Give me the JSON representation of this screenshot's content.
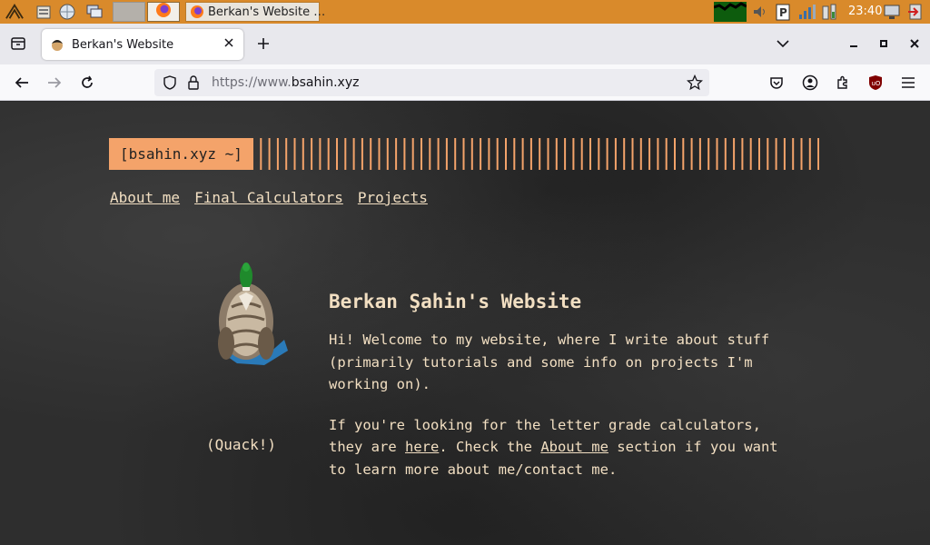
{
  "taskbar": {
    "window_title": "Berkan's Website …",
    "clock": "23:40",
    "icons": [
      "app-menu-icon",
      "file-manager-icon",
      "web-browser-icon",
      "desktop-icon",
      "firefox-icon",
      "cpu-monitor-icon",
      "volume-icon",
      "clipboard-icon",
      "network-icon",
      "battery-icon",
      "display-icon",
      "logout-icon"
    ]
  },
  "browser": {
    "tab_title": "Berkan's Website",
    "url_prefix": "https://www.",
    "url_domain": "bsahin.xyz",
    "accent": "#f4a36a"
  },
  "page": {
    "site_title": "[bsahin.xyz ~]",
    "nav": [
      "About me",
      "Final Calculators",
      "Projects"
    ],
    "duck_caption": "(Quack!)",
    "heading": "Berkan Şahin's Website",
    "intro": "Hi! Welcome to my website, where I write about stuff (primarily tutorials and some info on projects I'm working on).",
    "para2_a": "If you're looking for the letter grade calculators, they are ",
    "para2_link1": "here",
    "para2_b": ". Check the ",
    "para2_link2": "About me",
    "para2_c": " section if you want to learn more about me/contact me."
  }
}
